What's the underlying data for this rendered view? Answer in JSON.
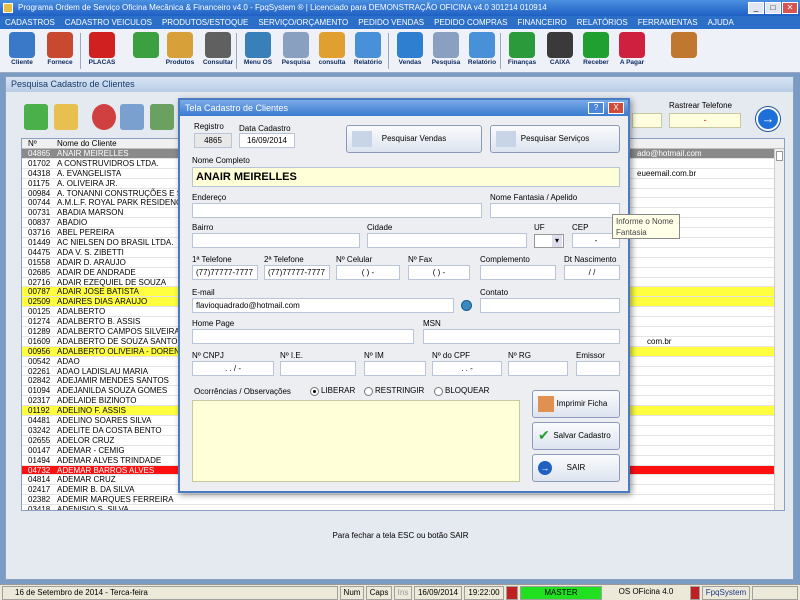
{
  "window": {
    "title": "Programa Ordem de Serviço Oficina Mecânica & Financeiro v4.0 - FpqSystem ® | Licenciado para  DEMONSTRAÇÃO OFICINA v4.0 301214 010914"
  },
  "menu": [
    "CADASTROS",
    "CADASTRO VEICULOS",
    "PRODUTOS/ESTOQUE",
    "SERVIÇO/ORÇAMENTO",
    "PEDIDO VENDAS",
    "PEDIDO COMPRAS",
    "FINANCEIRO",
    "RELATÓRIOS",
    "FERRAMENTAS",
    "AJUDA"
  ],
  "toolbar": [
    {
      "label": "Cliente",
      "icon": "customer-icon",
      "color": "#3a78c8"
    },
    {
      "label": "Fornece",
      "icon": "supplier-icon",
      "color": "#c84830"
    },
    {
      "label": "PLACAS",
      "icon": "car-icon",
      "color": "#d02020"
    },
    {
      "label": "",
      "icon": "clock-icon",
      "color": "#3aa040"
    },
    {
      "label": "Produtos",
      "icon": "boxes-icon",
      "color": "#d8a038"
    },
    {
      "label": "Consultar",
      "icon": "barcode-icon",
      "color": "#606060"
    },
    {
      "label": "Menu OS",
      "icon": "clipboard-icon",
      "color": "#3a80b8"
    },
    {
      "label": "Pesquisa",
      "icon": "search-doc-icon",
      "color": "#8aa0c0"
    },
    {
      "label": "consulta",
      "icon": "folder-icon",
      "color": "#e0a030"
    },
    {
      "label": "Relatório",
      "icon": "printer-icon",
      "color": "#4890d8"
    },
    {
      "label": "Vendas",
      "icon": "monitor-icon",
      "color": "#2f7fd0"
    },
    {
      "label": "Pesquisa",
      "icon": "search-doc-icon",
      "color": "#8aa0c0"
    },
    {
      "label": "Relatório",
      "icon": "printer-icon",
      "color": "#4890d8"
    },
    {
      "label": "Finanças",
      "icon": "money-icon",
      "color": "#2a9a3a"
    },
    {
      "label": "CAIXA",
      "icon": "cash-icon",
      "color": "#3a3a3a"
    },
    {
      "label": "Receber",
      "icon": "dollar-green-icon",
      "color": "#20a030"
    },
    {
      "label": "A Pagar",
      "icon": "dollar-red-icon",
      "color": "#d02040"
    },
    {
      "label": "",
      "icon": "exit-door-icon",
      "color": "#c07830"
    }
  ],
  "panel": {
    "title": "Pesquisa Cadastro de Clientes",
    "rastrear_label": "Rastrear Telefone",
    "rastrear_value": "-",
    "grid_headers": [
      "Nº",
      "Nome do Cliente"
    ],
    "rows": [
      {
        "n": "04865",
        "name": "ANAIR MEIRELLES",
        "style": "gray",
        "extra": "ado@hotmail.com"
      },
      {
        "n": "01702",
        "name": "A CONSTRUVIDROS LTDA.",
        "style": "",
        "extra": ""
      },
      {
        "n": "04318",
        "name": "A. EVANGELISTA",
        "style": "",
        "extra": "eueemail.com.br"
      },
      {
        "n": "01175",
        "name": "A. OLIVEIRA JR.",
        "style": "",
        "extra": ""
      },
      {
        "n": "00984",
        "name": "A. TONANNI CONSTRUÇÕES E SERV",
        "style": "",
        "extra": ""
      },
      {
        "n": "00744",
        "name": "A.M.L.F. ROYAL PARK RESIDENCE",
        "style": "",
        "extra": ""
      },
      {
        "n": "00731",
        "name": "ABADIA MARSON",
        "style": "",
        "extra": ""
      },
      {
        "n": "00837",
        "name": "ABADIO",
        "style": "",
        "extra": ""
      },
      {
        "n": "03716",
        "name": "ABEL PEREIRA",
        "style": "",
        "extra": ""
      },
      {
        "n": "01449",
        "name": "AC NIELSEN DO BRASIL LTDA.",
        "style": "",
        "extra": ""
      },
      {
        "n": "04475",
        "name": "ADA V. S. ZIBETTI",
        "style": "",
        "extra": ""
      },
      {
        "n": "01558",
        "name": "ADAIR D. ARAUJO",
        "style": "",
        "extra": ""
      },
      {
        "n": "02685",
        "name": "ADAIR DE ANDRADE",
        "style": "",
        "extra": ""
      },
      {
        "n": "02716",
        "name": "ADAIR EZEQUIEL DE SOUZA",
        "style": "",
        "extra": ""
      },
      {
        "n": "00787",
        "name": "ADAIR JOSE BATISTA",
        "style": "yellow",
        "extra": ""
      },
      {
        "n": "02509",
        "name": "ADAIRES DIAS ARAUJO",
        "style": "yellow",
        "extra": ""
      },
      {
        "n": "00125",
        "name": "ADALBERTO",
        "style": "",
        "extra": ""
      },
      {
        "n": "01274",
        "name": "ADALBERTO B. ASSIS",
        "style": "",
        "extra": ""
      },
      {
        "n": "01289",
        "name": "ADALBERTO CAMPOS SILVEIRA",
        "style": "",
        "extra": ""
      },
      {
        "n": "01609",
        "name": "ADALBERTO DE SOUZA SANTOS",
        "style": "",
        "extra": "com.br"
      },
      {
        "n": "00956",
        "name": "ADALBERTO OLIVEIRA - DORENSE",
        "style": "yellow",
        "extra": ""
      },
      {
        "n": "00542",
        "name": "ADAO",
        "style": "",
        "extra": ""
      },
      {
        "n": "02261",
        "name": "ADAO LADISLAU MARIA",
        "style": "",
        "extra": ""
      },
      {
        "n": "02842",
        "name": "ADEJAMIR MENDES SANTOS",
        "style": "",
        "extra": ""
      },
      {
        "n": "01094",
        "name": "ADEJANILDA SOUZA GOMES",
        "style": "",
        "extra": ""
      },
      {
        "n": "02317",
        "name": "ADELAIDE BIZINOTO",
        "style": "",
        "extra": ""
      },
      {
        "n": "01192",
        "name": "ADELINO F. ASSIS",
        "style": "yellow",
        "extra": ""
      },
      {
        "n": "04481",
        "name": "ADELINO SOARES SILVA",
        "style": "",
        "extra": ""
      },
      {
        "n": "03242",
        "name": "ADELITE DA COSTA BENTO",
        "style": "",
        "extra": ""
      },
      {
        "n": "02655",
        "name": "ADELOR CRUZ",
        "style": "",
        "extra": ""
      },
      {
        "n": "00147",
        "name": "ADEMAR - CEMIG",
        "style": "",
        "extra": ""
      },
      {
        "n": "01494",
        "name": "ADEMAR ALVES TRINDADE",
        "style": "",
        "extra": ""
      },
      {
        "n": "04732",
        "name": "ADEMAR BARROS ALVES",
        "style": "red",
        "extra": ""
      },
      {
        "n": "04814",
        "name": "ADEMAR CRUZ",
        "style": "",
        "extra": ""
      },
      {
        "n": "02417",
        "name": "ADEMIR B. DA SILVA",
        "style": "",
        "extra": ""
      },
      {
        "n": "02382",
        "name": "ADEMIR MARQUES FERREIRA",
        "style": "",
        "extra": ""
      },
      {
        "n": "03418",
        "name": "ADENISIO S. SILVA",
        "style": "",
        "extra": ""
      }
    ],
    "hint": "Para fechar a tela ESC ou botão SAIR"
  },
  "dialog": {
    "title": "Tela Cadastro de Clientes",
    "registro_label": "Registro",
    "registro": "4865",
    "data_cadastro_label": "Data Cadastro",
    "data_cadastro": "16/09/2014",
    "pesquisar_vendas": "Pesquisar Vendas",
    "pesquisar_servicos": "Pesquisar Serviços",
    "nome_label": "Nome Completo",
    "nome": "ANAIR MEIRELLES",
    "endereco_label": "Endereço",
    "fantasia_label": "Nome Fantasia / Apelido",
    "bairro_label": "Bairro",
    "cidade_label": "Cidade",
    "uf_label": "UF",
    "cep_label": "CEP",
    "cep": "-",
    "tel1_label": "1ª Telefone",
    "tel1": "(77)77777-7777",
    "tel2_label": "2ª Telefone",
    "tel2": "(77)77777-7777",
    "cel_label": "Nº Celular",
    "cel": "(  )    -",
    "fax_label": "Nº Fax",
    "fax": "(  )    -",
    "complemento_label": "Complemento",
    "nasc_label": "Dt Nascimento",
    "nasc": "/  /",
    "email_label": "E-mail",
    "email": "flavioquadrado@hotmail.com",
    "contato_label": "Contato",
    "homepage_label": "Home Page",
    "msn_label": "MSN",
    "cnpj_label": "Nº CNPJ",
    "cnpj": ".   .   /   -",
    "ie_label": "Nº I.E.",
    "im_label": "Nº IM",
    "cpf_label": "Nº do CPF",
    "cpf": ".   .   -",
    "rg_label": "Nº RG",
    "emissor_label": "Emissor",
    "obs_label": "Ocorrências / Observações",
    "radio_liberar": "LIBERAR",
    "radio_restringir": "RESTRINGIR",
    "radio_bloquear": "BLOQUEAR",
    "imprimir": "Imprimir Ficha",
    "salvar": "Salvar Cadastro",
    "sair": "SAIR",
    "help_btn": "?",
    "close_btn": "X"
  },
  "tooltip": "Informe o Nome Fantasia",
  "status": {
    "date_text": "16 de Setembro de 2014 - Terca-feira",
    "num": "Num",
    "caps": "Caps",
    "ins": "Ins",
    "date": "16/09/2014",
    "time": "19:22:00",
    "master": "MASTER",
    "app": "OS OFicina 4.0",
    "brand": "FpqSystem"
  }
}
